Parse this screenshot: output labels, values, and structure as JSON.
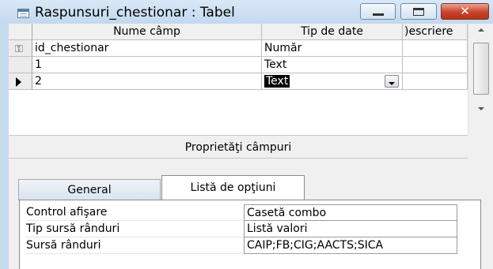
{
  "window": {
    "title": "Raspunsuri_chestionar : Tabel",
    "close_glyph": "✕"
  },
  "grid": {
    "headers": {
      "name": "Nume câmp",
      "type": "Tip de date",
      "description": ")escriere"
    },
    "rows": [
      {
        "name": "id_chestionar",
        "type": "Număr",
        "is_key": true,
        "current": false
      },
      {
        "name": "1",
        "type": "Text",
        "is_key": false,
        "current": false
      },
      {
        "name": "2",
        "type": "Text",
        "is_key": false,
        "current": true
      }
    ]
  },
  "properties": {
    "title": "Proprietăţi câmpuri",
    "tabs": [
      {
        "label": "General",
        "active": false
      },
      {
        "label": "Listă de opţiuni",
        "active": true
      }
    ],
    "rows": [
      {
        "label": "Control afişare",
        "value": "Casetă combo"
      },
      {
        "label": "Tip sursă rânduri",
        "value": "Listă valori"
      },
      {
        "label": "Sursă rânduri",
        "value": "CAIP;FB;CIG;AACTS;SICA"
      }
    ]
  }
}
